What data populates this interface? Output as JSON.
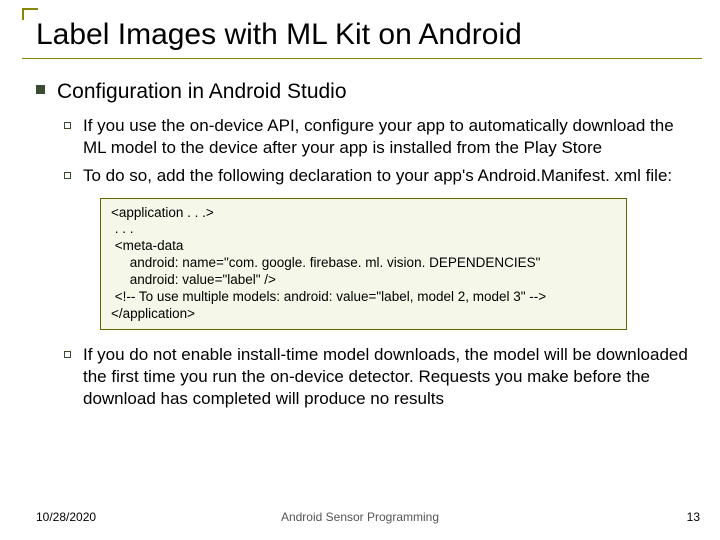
{
  "title": "Label Images with ML Kit on Android",
  "section": "Configuration in Android Studio",
  "bullets": {
    "b1": "If you use the on-device API, configure your app to automatically download the ML model to the device after your app is installed from the Play Store",
    "b2": "To do so, add the following declaration to your app's Android.Manifest. xml file:",
    "b3": "If you do not enable install-time model downloads, the model will be downloaded the first time you run the on-device detector. Requests you make before the download has completed will produce no results"
  },
  "code": "<application . . .>\n . . .\n <meta-data\n     android: name=\"com. google. firebase. ml. vision. DEPENDENCIES\"\n     android: value=\"label\" />\n <!-- To use multiple models: android: value=\"label, model 2, model 3\" -->\n</application>",
  "footer": {
    "date": "10/28/2020",
    "center": "Android Sensor Programming",
    "page": "13"
  }
}
